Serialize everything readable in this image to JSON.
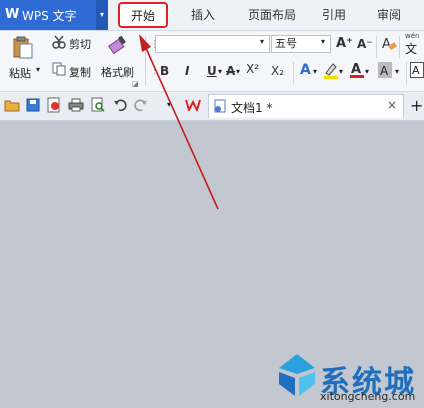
{
  "app": {
    "logo": "W",
    "title": "WPS 文字",
    "dropdown": "▾"
  },
  "tabs": [
    "开始",
    "插入",
    "页面布局",
    "引用",
    "审阅"
  ],
  "ribbon": {
    "paste": "粘贴",
    "cut": "剪切",
    "copy": "复制",
    "format_painter": "格式刷",
    "font_name": "",
    "font_size": "五号",
    "bold": "B",
    "italic": "I",
    "underline": "U",
    "strike": "A",
    "superscript": "X²",
    "subscript": "X₂",
    "grow_font": "A⁺",
    "shrink_font": "A⁻",
    "wen": "wén",
    "wen_char": "文"
  },
  "document_tab": {
    "label": "文档1 *",
    "close": "×",
    "add": "+"
  },
  "watermark": {
    "brand": "系统城",
    "url": "xitongcheng.com"
  },
  "colors": {
    "accent": "#2e6bd5",
    "highlight_box": "#dd2222",
    "arrow": "#c41e1e"
  }
}
